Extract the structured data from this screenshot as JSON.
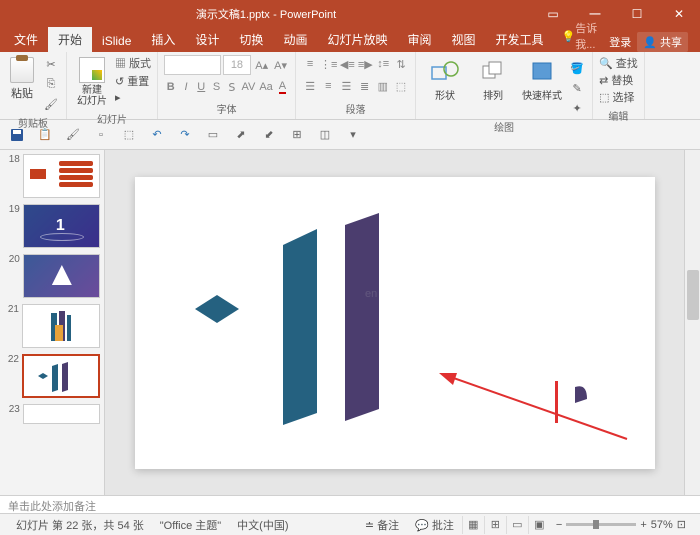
{
  "titlebar": {
    "filename": "演示文稿1.pptx",
    "app": "PowerPoint"
  },
  "tabs": {
    "file": "文件",
    "home": "开始",
    "islide": "iSlide",
    "insert": "插入",
    "design": "设计",
    "transitions": "切换",
    "animations": "动画",
    "slideshow": "幻灯片放映",
    "review": "审阅",
    "view": "视图",
    "devtools": "开发工具",
    "tell": "告诉我...",
    "login": "登录",
    "share": "共享"
  },
  "ribbon": {
    "clipboard": {
      "paste": "粘贴",
      "label": "剪贴板"
    },
    "slides": {
      "new": "新建\n幻灯片",
      "layout": "版式",
      "reset": "重置",
      "label": "幻灯片"
    },
    "font": {
      "size": "18",
      "label": "字体"
    },
    "paragraph": {
      "label": "段落"
    },
    "drawing": {
      "shapes": "形状",
      "arrange": "排列",
      "fastdress": "快速样式",
      "label": "绘图"
    },
    "editing": {
      "find": "查找",
      "replace": "替换",
      "select": "选择",
      "label": "编辑"
    }
  },
  "notes": {
    "placeholder": "单击此处添加备注"
  },
  "status": {
    "slideinfo": "幻灯片 第 22 张，共 54 张",
    "theme": "\"Office 主题\"",
    "lang": "中文(中国)",
    "comments": "备注",
    "review": "批注",
    "zoom": "57%"
  },
  "thumbs": [
    {
      "num": "18"
    },
    {
      "num": "19"
    },
    {
      "num": "20"
    },
    {
      "num": "21"
    },
    {
      "num": "22",
      "sel": true
    },
    {
      "num": "23"
    }
  ]
}
